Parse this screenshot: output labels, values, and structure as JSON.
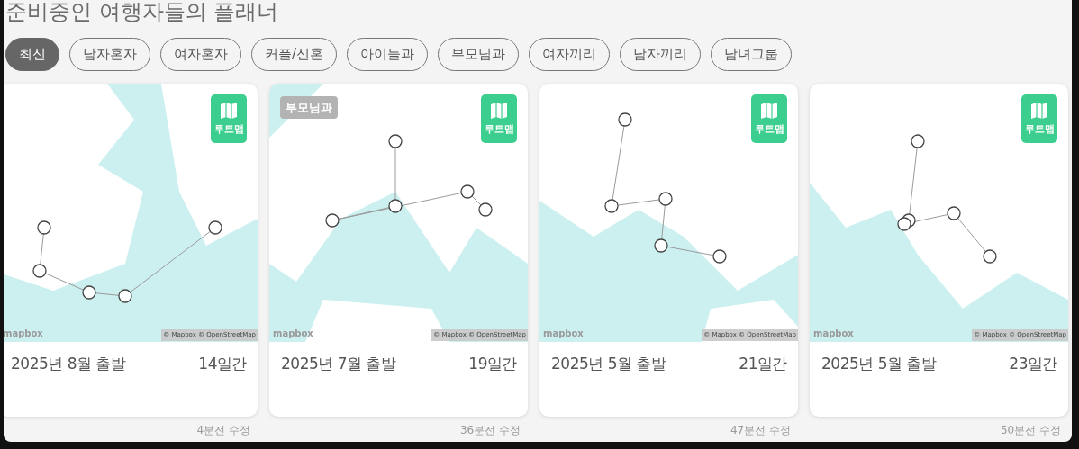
{
  "title": "준비중인 여행자들의 플래너",
  "filters": [
    {
      "label": "최신",
      "selected": true
    },
    {
      "label": "남자혼자",
      "selected": false
    },
    {
      "label": "여자혼자",
      "selected": false
    },
    {
      "label": "커플/신혼",
      "selected": false
    },
    {
      "label": "아이들과",
      "selected": false
    },
    {
      "label": "부모님과",
      "selected": false
    },
    {
      "label": "여자끼리",
      "selected": false
    },
    {
      "label": "남자끼리",
      "selected": false
    },
    {
      "label": "남녀그룹",
      "selected": false
    }
  ],
  "plans": [
    {
      "map": {
        "kind": "picture",
        "badge": "루트맵",
        "logo": "mapbox",
        "attribution": "© Mapbox © OpenStreetMap"
      },
      "departure": "2025년 8월 출발",
      "duration": "14일간",
      "updated": "4분전 수정"
    },
    {
      "tag": "부모님과",
      "map": {
        "kind": "picture",
        "badge": "루트맵",
        "logo": "mapbox",
        "attribution": "© Mapbox © OpenStreetMap"
      },
      "departure": "2025년 7월 출발",
      "duration": "19일간",
      "updated": "36분전 수정"
    },
    {
      "map": {
        "kind": "picture",
        "badge": "루트맵",
        "logo": "mapbox",
        "attribution": "© Mapbox © OpenStreetMap"
      },
      "departure": "2025년 5월 출발",
      "duration": "21일간",
      "updated": "47분전 수정"
    },
    {
      "map": {
        "kind": "picture",
        "badge": "루트맵",
        "logo": "mapbox",
        "attribution": "© Mapbox © OpenStreetMap"
      },
      "departure": "2025년 5월 출발",
      "duration": "23일간",
      "updated": "50분전 수정"
    }
  ]
}
